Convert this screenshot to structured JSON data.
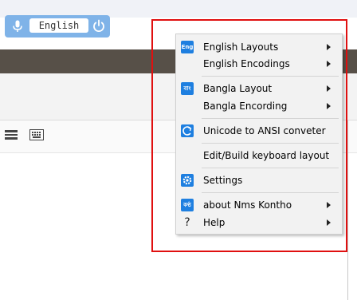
{
  "keyboard_widget": {
    "language": "English",
    "accent_color": "#7fb3e8"
  },
  "menu": {
    "items": [
      {
        "label": "English Layouts",
        "icon": "eng-badge-icon",
        "badge_text": "Eng",
        "submenu": true
      },
      {
        "label": "English Encodings",
        "icon": "",
        "submenu": true
      },
      {
        "label": "Bangla Layout",
        "icon": "bangla-badge-icon",
        "badge_text": "বাং",
        "submenu": true
      },
      {
        "label": "Bangla Encording",
        "icon": "",
        "submenu": true
      },
      {
        "label": "Unicode to ANSI conveter",
        "icon": "convert-icon",
        "submenu": false
      },
      {
        "label": "Edit/Build keyboard layout",
        "icon": "",
        "submenu": false
      },
      {
        "label": "Settings",
        "icon": "gear-icon",
        "submenu": false
      },
      {
        "label": "about Nms Kontho",
        "icon": "kontho-badge-icon",
        "badge_text": "কণ্ঠ",
        "submenu": true
      },
      {
        "label": "Help",
        "icon": "question-icon",
        "badge_text": "?",
        "submenu": true
      }
    ]
  },
  "colors": {
    "highlight": "#e01010",
    "dark_bar": "#575048",
    "icon_blue": "#1e7fe0"
  }
}
